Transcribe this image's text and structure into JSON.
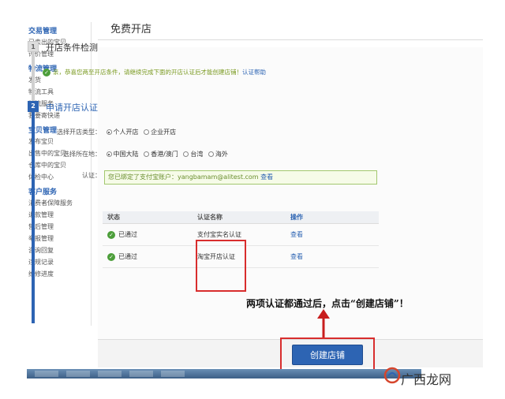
{
  "sidebar": {
    "groups": [
      {
        "title": "交易管理",
        "items": [
          "已卖出的宝贝",
          "评价管理"
        ]
      },
      {
        "title": "物流管理",
        "items": [
          "发货",
          "物流工具",
          "物流服务",
          "我要寄快递"
        ]
      },
      {
        "title": "宝贝管理",
        "items": [
          "发布宝贝",
          "出售中的宝贝",
          "仓库中的宝贝",
          "体检中心"
        ]
      },
      {
        "title": "客户服务",
        "items": [
          "消费者保障服务",
          "退款管理",
          "售后管理",
          "举报管理",
          "咨询回复",
          "违规记录",
          "维修进度"
        ]
      }
    ]
  },
  "page": {
    "title": "免费开店"
  },
  "steps": [
    {
      "num": "1",
      "title": "开店条件检测"
    },
    {
      "num": "2",
      "title": "申请开店认证"
    }
  ],
  "notice": {
    "text": "亲，恭喜您两至开店条件，请继续完成下面的开店认证后才能创建店铺！",
    "link": "认证帮助"
  },
  "form": {
    "type_label": "选择开店类型：",
    "type_options": [
      "个人开店",
      "企业开店"
    ],
    "region_label": "选择所在地：",
    "region_options": [
      "中国大陆",
      "香港/澳门",
      "台湾",
      "海外"
    ],
    "cert_label": "认证：",
    "cert_text": "您已绑定了支付宝账户：yangbamam@alitest.com",
    "cert_link": "查看"
  },
  "table": {
    "headers": [
      "状态",
      "认证名称",
      "操作"
    ],
    "rows": [
      {
        "status": "已通过",
        "name": "支付宝实名认证",
        "action": "查看"
      },
      {
        "status": "已通过",
        "name": "淘宝开店认证",
        "action": "查看"
      }
    ]
  },
  "annotation": "两项认证都通过后，点击“创建店铺”！",
  "button": {
    "create": "创建店铺"
  },
  "watermark": "广西龙网",
  "colors": {
    "accent": "#2d64b3",
    "success": "#4c9e3a",
    "highlight": "#d82d2d"
  }
}
